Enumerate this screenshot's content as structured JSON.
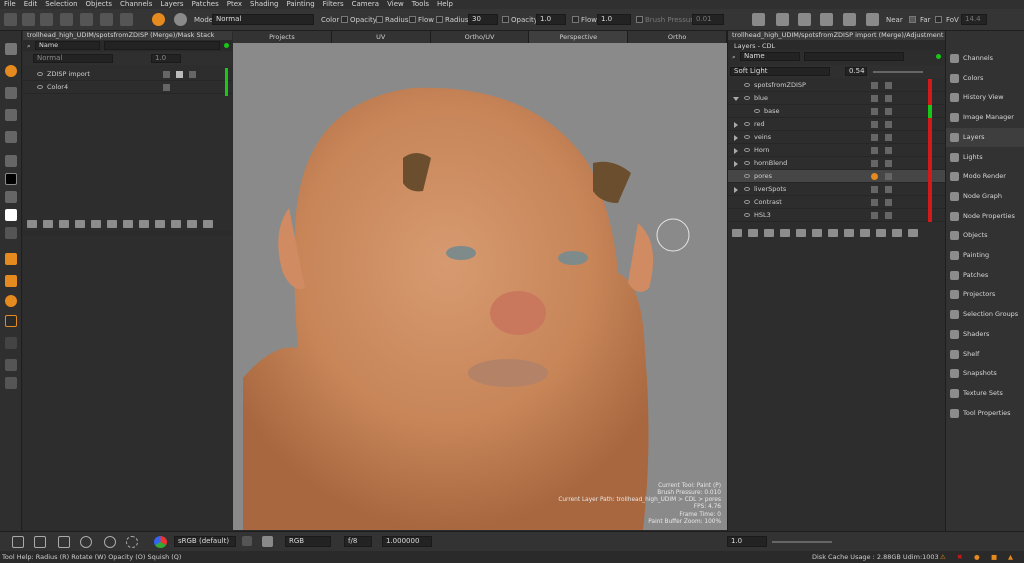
{
  "menu": [
    "File",
    "Edit",
    "Selection",
    "Objects",
    "Channels",
    "Layers",
    "Patches",
    "Ptex",
    "Shading",
    "Painting",
    "Filters",
    "Camera",
    "View",
    "Tools",
    "Help"
  ],
  "toolbar": {
    "mode_label": "Mode",
    "mode_value": "Normal",
    "color_label": "Color",
    "opacity_label": "Opacity",
    "radius_check_label": "Radius",
    "flow_check_label": "Flow",
    "radius_label": "Radius",
    "radius_value": "30",
    "opacity_field_label": "Opacity",
    "opacity_value": "1.0",
    "flow_label": "Flow",
    "flow_value": "1.0",
    "brush_pressure_label": "Brush Pressure",
    "brush_pressure_value": "0.01",
    "near_label": "Near",
    "far_label": "Far",
    "fov_label": "FoV",
    "fov_value": "14.4"
  },
  "mask_stack": {
    "title": "trollhead_high_UDIM/spotsfromZDISP (Merge)/Mask Stack",
    "search_label": "Name",
    "blend_mode": "Normal",
    "opacity": "1.0",
    "layers": [
      {
        "name": "ZDISP import"
      },
      {
        "name": "Color4"
      }
    ]
  },
  "viewport": {
    "tabs": [
      "Projects",
      "UV",
      "Ortho/UV",
      "Perspective",
      "Ortho"
    ],
    "active_tab": "Perspective",
    "stats": [
      "Current Tool: Paint (P)",
      "Brush Pressure: 0.010",
      "Current Layer Path: trollhead_high_UDIM > CDL > pores",
      "FPS: 4.76",
      "Frame Time: 0",
      "Paint Buffer Zoom: 100%"
    ]
  },
  "adjustment_stack": {
    "title": "trollhead_high_UDIM/spotsfromZDISP import (Merge)/Adjustment Stack",
    "layers_header": "Layers - CDL",
    "search_label": "Name",
    "blend_mode": "Soft Light",
    "opacity": "0.54",
    "layers": [
      {
        "name": "spotsfromZDISP",
        "expander": "none"
      },
      {
        "name": "blue",
        "expander": "down"
      },
      {
        "name": "base",
        "expander": "none",
        "indent": 1
      },
      {
        "name": "red",
        "expander": "right"
      },
      {
        "name": "veins",
        "expander": "right"
      },
      {
        "name": "Horn",
        "expander": "right"
      },
      {
        "name": "hornBlend",
        "expander": "right"
      },
      {
        "name": "pores",
        "expander": "none",
        "selected": true
      },
      {
        "name": "liverSpots",
        "expander": "right"
      },
      {
        "name": "Contrast",
        "expander": "none"
      },
      {
        "name": "HSL3",
        "expander": "none"
      }
    ]
  },
  "right_tabs": [
    "Channels",
    "Colors",
    "History View",
    "Image Manager",
    "Layers",
    "Lights",
    "Modo Render",
    "Node Graph",
    "Node Properties",
    "Objects",
    "Painting",
    "Patches",
    "Projectors",
    "Selection Groups",
    "Shaders",
    "Shelf",
    "Snapshots",
    "Texture Sets",
    "Tool Properties"
  ],
  "active_right_tab": "Layers",
  "bottom": {
    "colorspace": "sRGB (default)",
    "channel": "RGB",
    "fstop": "f/8",
    "exposure": "1.000000",
    "gamma": "1.0"
  },
  "status": {
    "hints": "Tool Help:   Radius (R)   Rotate (W)   Opacity (O)   Squish (Q)",
    "disk_cache": "Disk Cache Usage : 2.88GB  Udim:1003"
  },
  "colors": {
    "accent_orange": "#e58a1f",
    "status_red": "#d11a1a",
    "status_green": "#19c719"
  }
}
